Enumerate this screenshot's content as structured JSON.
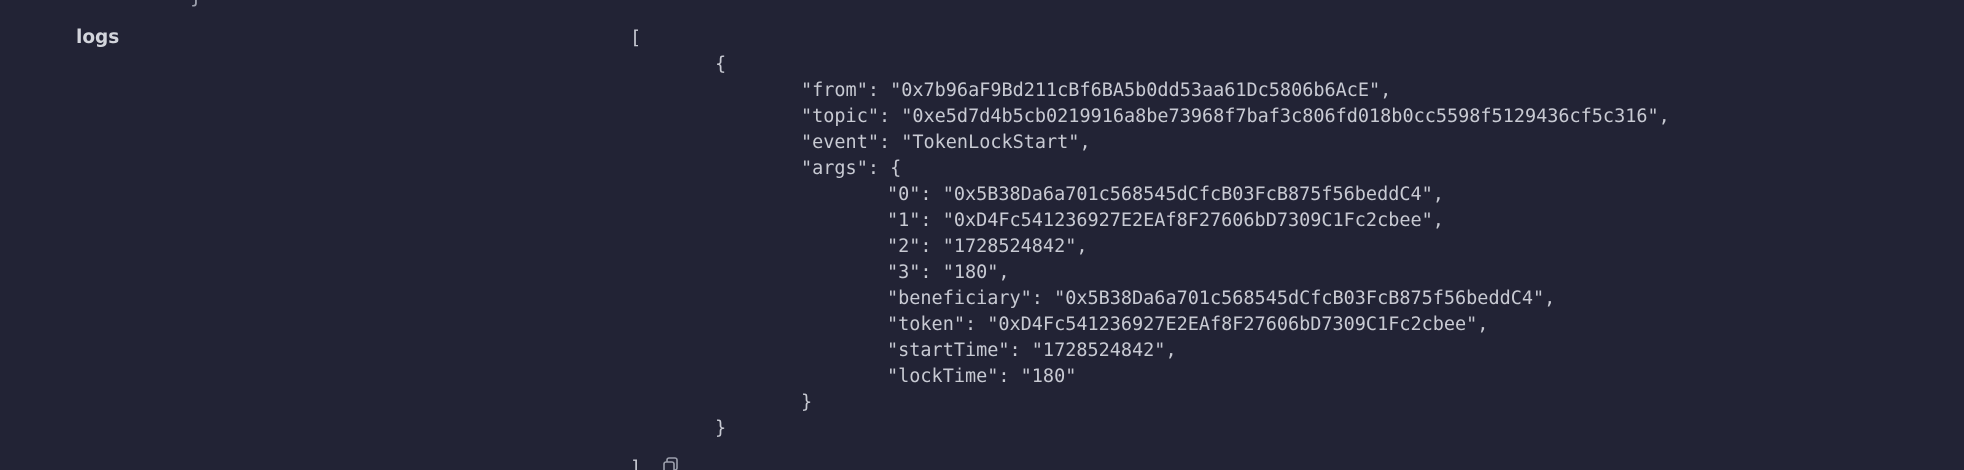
{
  "top_fragment": "}",
  "row": {
    "label": "logs"
  },
  "logs_json": {
    "lines": [
      "[",
      "{",
      "\"from\": \"0x7b96aF9Bd211cBf6BA5b0dd53aa61Dc5806b6AcE\",",
      "\"topic\": \"0xe5d7d4b5cb0219916a8be73968f7baf3c806fd018b0cc5598f5129436cf5c316\",",
      "\"event\": \"TokenLockStart\",",
      "\"args\": {",
      "\"0\": \"0x5B38Da6a701c568545dCfcB03FcB875f56beddC4\",",
      "\"1\": \"0xD4Fc541236927E2EAf8F27606bD7309C1Fc2cbee\",",
      "\"2\": \"1728524842\",",
      "\"3\": \"180\",",
      "\"beneficiary\": \"0x5B38Da6a701c568545dCfcB03FcB875f56beddC4\",",
      "\"token\": \"0xD4Fc541236927E2EAf8F27606bD7309C1Fc2cbee\",",
      "\"startTime\": \"1728524842\",",
      "\"lockTime\": \"180\"",
      "}",
      "}",
      "]"
    ]
  },
  "icons": {
    "copy": "copy-icon"
  },
  "colors": {
    "background": "#222335",
    "text": "#c8cad3"
  }
}
